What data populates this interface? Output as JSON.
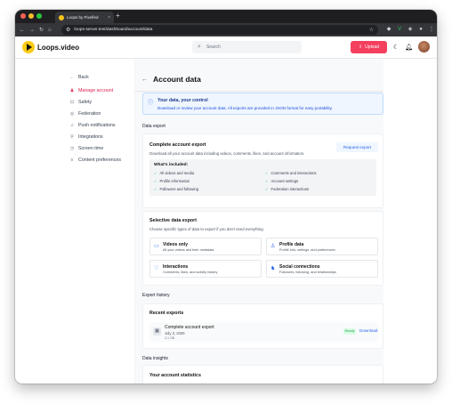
{
  "browser": {
    "tab_title": "Loops by Pixelfed",
    "tab_close": "×",
    "new_tab": "+",
    "url": "loops-server.test/dashboard/account/data"
  },
  "header": {
    "brand": "Loops.video",
    "search_placeholder": "Search",
    "upload_label": "Upload"
  },
  "sidebar": {
    "back_label": "Back",
    "items": [
      {
        "label": "Manage account",
        "icon": "user-icon",
        "active": true
      },
      {
        "label": "Safety",
        "icon": "lock-icon",
        "active": false
      },
      {
        "label": "Federation",
        "icon": "globe-icon",
        "active": false
      },
      {
        "label": "Push notifications",
        "icon": "bell-icon",
        "active": false
      },
      {
        "label": "Integrations",
        "icon": "plug-icon",
        "active": false
      },
      {
        "label": "Screen time",
        "icon": "clock-icon",
        "active": false
      },
      {
        "label": "Content preferences",
        "icon": "sliders-icon",
        "active": false
      }
    ]
  },
  "page": {
    "title": "Account data",
    "info": {
      "title": "Your data, your control",
      "desc": "Download or review your account data. All exports are provided in JSON format for easy portability."
    },
    "data_export_label": "Data export",
    "complete": {
      "title": "Complete account export",
      "desc": "Download all your account data including videos, comments, likes, and account information.",
      "button": "Request export",
      "included_title": "What's included:",
      "included": [
        "All videos and media",
        "Comments and interactions",
        "Profile information",
        "Account settings",
        "Followers and following",
        "Federation interactions"
      ]
    },
    "selective": {
      "title": "Selective data export",
      "desc": "Choose specific types of data to export if you don't need everything.",
      "options": [
        {
          "title": "Videos only",
          "desc": "All your videos and their metadata",
          "icon": "video-icon"
        },
        {
          "title": "Profile data",
          "desc": "Profile info, settings, and preferences",
          "icon": "profile-icon"
        },
        {
          "title": "Interactions",
          "desc": "Comments, likes, and activity history",
          "icon": "heart-icon"
        },
        {
          "title": "Social connections",
          "desc": "Followers, following, and relationships",
          "icon": "users-icon"
        }
      ]
    },
    "history_label": "Export history",
    "recent": {
      "title": "Recent exports",
      "item": {
        "title": "Complete account export",
        "date": "July 3, 2025",
        "size": "2.1 GB",
        "status": "Ready",
        "action": "Download"
      }
    },
    "insights_label": "Data insights",
    "stats_title": "Your account statistics"
  },
  "colors": {
    "accent": "#f43f5e",
    "link": "#2563eb",
    "active_nav": "#e11d48",
    "info_bg": "#eff6ff"
  }
}
